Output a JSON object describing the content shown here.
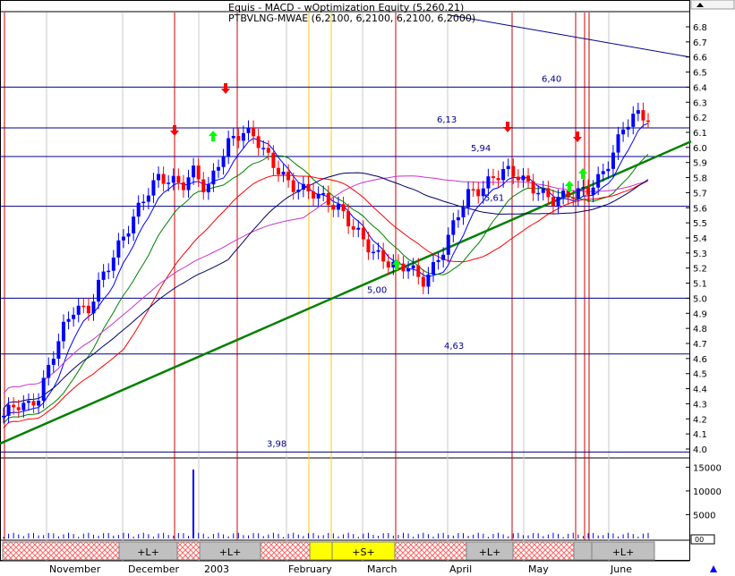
{
  "header": {
    "title_line": "Equis - MACD - wOptimization Equity (5,260.21)",
    "ticker_line": "PTBVLNG-MWAE (6,2100, 6,2100, 6,2100, 6,2000)"
  },
  "nav_icons": {
    "top": "scroll-up-arrow-icon",
    "bottom": "scroll-up-arrow-icon"
  },
  "colors": {
    "up_bar": "#0000ff",
    "down_bar": "#ff0000",
    "trendline": "#008000",
    "ma_fast": "#0000ff",
    "ma_mid": "#008000",
    "ma_slow": "#ff0000",
    "ma_long1": "#cc33cc",
    "ma_long2": "#000066",
    "event_line": "#cc0000",
    "vertical_highlight": "#ffcc00",
    "sell_arrow": "#ff0000",
    "buy_arrow": "#00ff00"
  },
  "chart_data": [
    {
      "type": "candlestick",
      "price_axis": {
        "min": 3.9,
        "max": 6.9,
        "ticks": [
          "4.0",
          "4.1",
          "4.2",
          "4.3",
          "4.4",
          "4.5",
          "4.6",
          "4.7",
          "4.8",
          "4.9",
          "5.0",
          "5.1",
          "5.2",
          "5.3",
          "5.4",
          "5.5",
          "5.6",
          "5.7",
          "5.8",
          "5.9",
          "6.0",
          "6.1",
          "6.2",
          "6.3",
          "6.4",
          "6.5",
          "6.6",
          "6.7",
          "6.8"
        ]
      },
      "x_labels": [
        "November",
        "December",
        "2003",
        "February",
        "March",
        "April",
        "May",
        "June"
      ],
      "horizontal_levels": [
        {
          "value": 6.4,
          "label": "6,40"
        },
        {
          "value": 6.13,
          "label": "6,13"
        },
        {
          "value": 5.94,
          "label": "5,94"
        },
        {
          "value": 5.61,
          "label": "5,61"
        },
        {
          "value": 5.0,
          "label": "5,00"
        },
        {
          "value": 4.63,
          "label": "4,63"
        },
        {
          "value": 3.98,
          "label": "3,98"
        }
      ],
      "trend_lines": [
        {
          "name": "support",
          "from": {
            "x_label": "start",
            "y": 4.0
          },
          "to": {
            "x_label": "end",
            "y": 6.04
          }
        },
        {
          "name": "resistance",
          "from": {
            "x_label": "mid",
            "y": 6.9
          },
          "to": {
            "x_label": "end",
            "y": 6.6
          }
        }
      ],
      "series": [
        {
          "name": "price",
          "close_path": [
            4.22,
            4.3,
            4.28,
            4.35,
            4.6,
            4.8,
            4.95,
            4.9,
            5.1,
            5.25,
            5.4,
            5.55,
            5.7,
            5.8,
            5.78,
            5.75,
            5.85,
            5.7,
            5.9,
            6.05,
            6.1,
            6.08,
            5.95,
            5.85,
            5.75,
            5.72,
            5.7,
            5.65,
            5.6,
            5.5,
            5.4,
            5.3,
            5.25,
            5.2,
            5.22,
            5.1,
            5.2,
            5.35,
            5.55,
            5.7,
            5.72,
            5.8,
            5.85,
            5.82,
            5.75,
            5.7,
            5.65,
            5.68,
            5.7,
            5.72,
            5.8,
            5.95,
            6.15,
            6.22,
            6.2
          ]
        }
      ],
      "signals": [
        {
          "type": "sell",
          "label": "December"
        },
        {
          "type": "sell",
          "label": "2003"
        },
        {
          "type": "sell",
          "label": "April"
        },
        {
          "type": "sell",
          "label": "May"
        },
        {
          "type": "buy",
          "label": "2003"
        },
        {
          "type": "buy",
          "label": "March"
        },
        {
          "type": "buy",
          "label": "May"
        },
        {
          "type": "buy",
          "label": "June"
        }
      ]
    },
    {
      "type": "bar",
      "name": "volume",
      "y_ticks": [
        "5000",
        "10000",
        "15000"
      ],
      "y_range": [
        0,
        16000
      ]
    }
  ],
  "signal_bar": {
    "segments": [
      {
        "label": "",
        "style": "hatch"
      },
      {
        "label": "+L+",
        "style": "gray"
      },
      {
        "label": "",
        "style": "hatch"
      },
      {
        "label": "+L+",
        "style": "gray"
      },
      {
        "label": "",
        "style": "hatch"
      },
      {
        "label": "",
        "style": "yellow"
      },
      {
        "label": "+S+",
        "style": "yellow"
      },
      {
        "label": "",
        "style": "hatch"
      },
      {
        "label": "+L+",
        "style": "gray"
      },
      {
        "label": "",
        "style": "hatch"
      },
      {
        "label": "",
        "style": "gray"
      },
      {
        "label": "+L+",
        "style": "gray"
      }
    ]
  },
  "corner_box_label": "00"
}
